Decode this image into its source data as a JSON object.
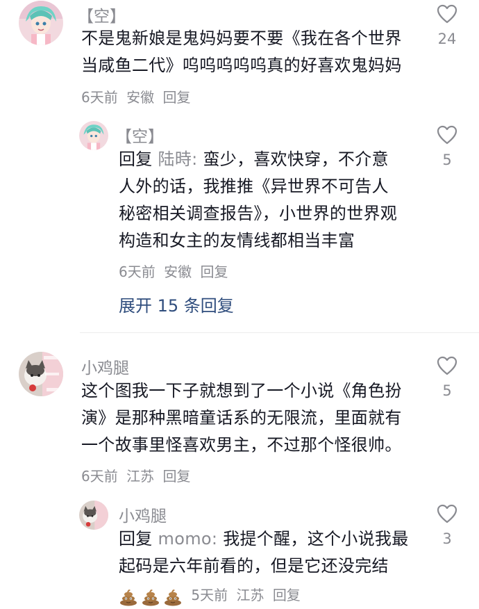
{
  "comments": [
    {
      "username": "【空】",
      "lines": [
        "不是鬼新娘是鬼妈妈要不要《我在各个世界",
        "当咸鱼二代》呜呜呜呜呜真的好喜欢鬼妈妈"
      ],
      "time": "6天前",
      "location": "安徽",
      "reply_label": "回复",
      "likes": "24",
      "replies": [
        {
          "username": "【空】",
          "reply_prefix": "回复",
          "reply_target": "陆時:",
          "lines": [
            " 蛮少，喜欢快穿，不介意",
            "人外的话，我推推《异世界不可告人",
            "秘密相关调查报告》，小世界的世界观",
            "构造和女主的友情线都相当丰富"
          ],
          "time": "6天前",
          "location": "安徽",
          "reply_label": "回复",
          "likes": "5"
        }
      ],
      "expand_label": "展开 15 条回复"
    },
    {
      "username": "小鸡腿",
      "lines": [
        "这个图我一下子就想到了一个小说《角色扮",
        "演》是那种黑暗童话系的无限流，里面就有",
        "一个故事里怪喜欢男主，不过那个怪很帅。"
      ],
      "time": "6天前",
      "location": "江苏",
      "reply_label": "回复",
      "likes": "5",
      "replies": [
        {
          "username": "小鸡腿",
          "reply_prefix": "回复",
          "reply_target": "momo:",
          "lines": [
            " 我提个醒，这个小说我最",
            "起码是六年前看的，但是它还没完结"
          ],
          "time": "5天前",
          "location": "江苏",
          "reply_label": "回复",
          "likes": "3",
          "emoji_count": 3
        }
      ]
    }
  ],
  "icons": {
    "like": "heart-outline-icon",
    "emoji": "poop-emoji-icon"
  },
  "colors": {
    "text": "#161823",
    "muted": "#8a8b91",
    "link": "#2f4d7d"
  }
}
